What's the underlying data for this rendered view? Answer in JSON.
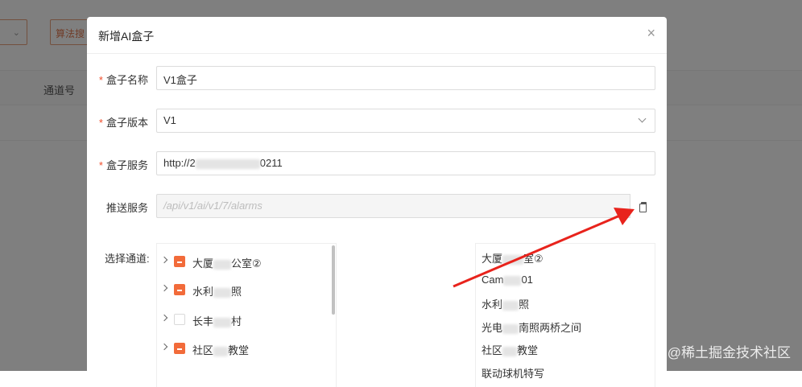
{
  "background": {
    "filter_input_text": "算法搜",
    "table_column": "通道号"
  },
  "modal": {
    "title": "新增AI盒子",
    "close_glyph": "×",
    "fields": {
      "name_label": "盒子名称",
      "name_value": "V1盒子",
      "version_label": "盒子版本",
      "version_value": "V1",
      "service_label": "盒子服务",
      "service_value_prefix": "http://2",
      "service_value_suffix": "0211",
      "push_label": "推送服务",
      "push_value": "/api/v1/ai/v1/7/alarms",
      "channel_label": "选择通道:"
    },
    "required_mark": "*",
    "tree": [
      {
        "label_a": "大厦",
        "label_b": "公室②",
        "state": "indeterminate"
      },
      {
        "label_a": "水利",
        "label_b": "照",
        "state": "indeterminate"
      },
      {
        "label_a": "长丰",
        "label_b": "村",
        "state": "unchecked"
      },
      {
        "label_a": "社区",
        "label_b": "教堂",
        "state": "indeterminate"
      }
    ],
    "selected": [
      {
        "label_a": "大厦",
        "label_b": "室②"
      },
      {
        "label_a": "Cam",
        "label_b": "01"
      },
      {
        "label_a": "水利",
        "label_b": "照"
      },
      {
        "label_a": "光电",
        "label_b": "南照两桥之间"
      },
      {
        "label_a": "社区",
        "label_b": "教堂"
      },
      {
        "label_a": "联动球机",
        "label_b": "特写"
      }
    ]
  },
  "watermark": "@稀土掘金技术社区",
  "colors": {
    "accent": "#f26b3a",
    "required": "#f04d2a",
    "annotation_arrow": "#e8231c"
  }
}
